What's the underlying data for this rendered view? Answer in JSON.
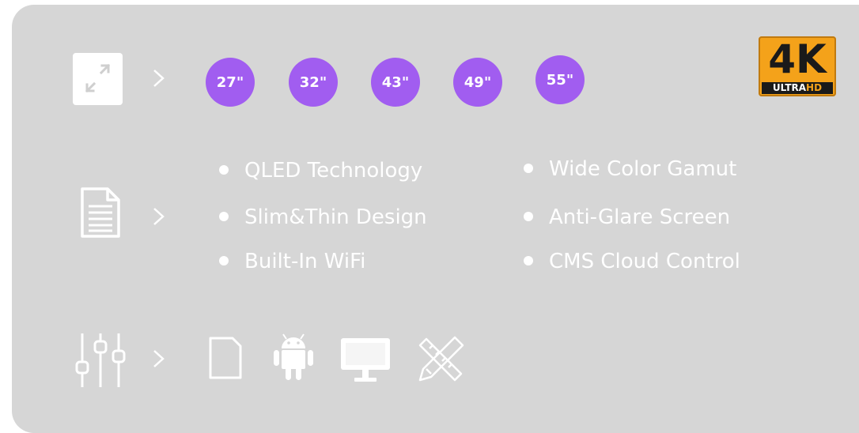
{
  "sizes": [
    "27\"",
    "32\"",
    "43\"",
    "49\"",
    "55\""
  ],
  "badge": {
    "big": "4K",
    "ultra": "ULTRA",
    "hd": "HD"
  },
  "features_left": [
    "QLED Technology",
    "Slim&Thin Design",
    "Built-In WiFi"
  ],
  "features_right": [
    "Wide Color Gamut",
    "Anti-Glare Screen",
    "CMS Cloud Control"
  ],
  "colors": {
    "panel": "#d6d6d6",
    "accent": "#a15df0",
    "badge_bg": "#f4a21a",
    "badge_text": "#1a1a1a",
    "icon": "#ffffff"
  },
  "icons": {
    "size_row": "expand-arrows-icon",
    "feature_row": "document-icon",
    "control_row": "sliders-icon",
    "connectivity": [
      "sd-card-icon",
      "android-icon",
      "monitor-icon",
      "design-tools-icon"
    ]
  }
}
